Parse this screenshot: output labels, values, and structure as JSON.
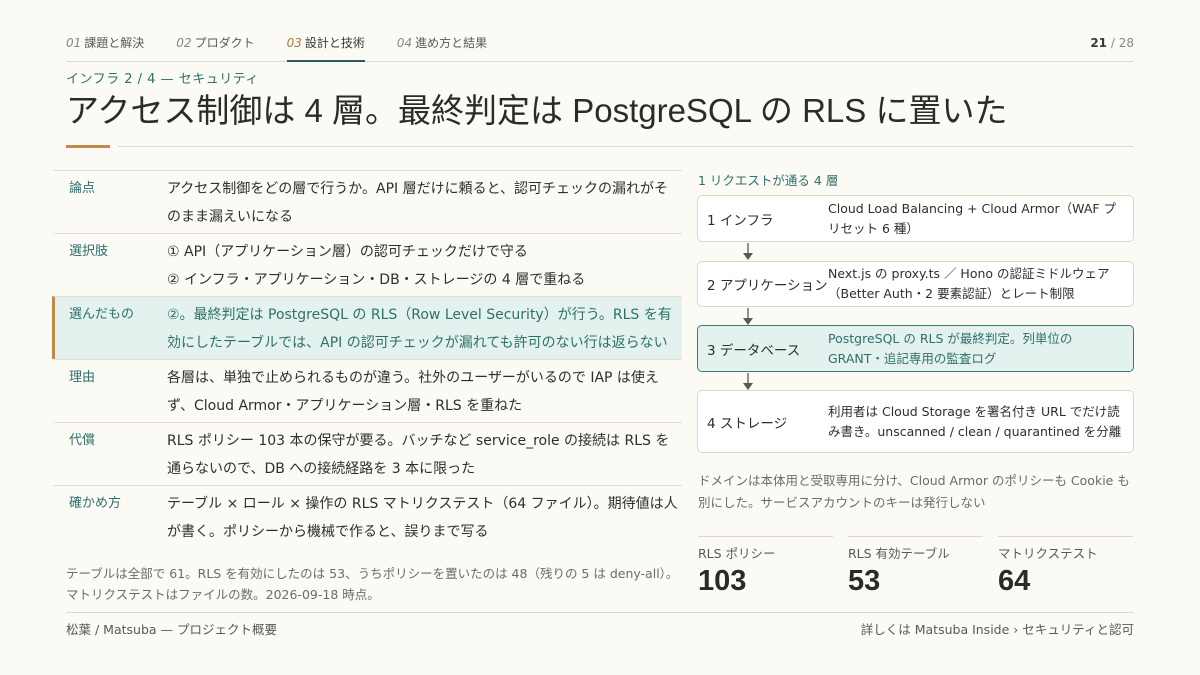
{
  "nav": {
    "tabs": [
      {
        "num": "01",
        "label": "課題と解決"
      },
      {
        "num": "02",
        "label": "プロダクト"
      },
      {
        "num": "03",
        "label": "設計と技術"
      },
      {
        "num": "04",
        "label": "進め方と結果"
      }
    ],
    "page_current": "21",
    "page_total": "/ 28"
  },
  "kicker": "インフラ 2 / 4 — セキュリティ",
  "title": "アクセス制御は 4 層。最終判定は PostgreSQL の RLS に置いた",
  "table": [
    {
      "label": "論点",
      "text": "アクセス制御をどの層で行うか。API 層だけに頼ると、認可チェックの漏れがそのまま漏えいになる"
    },
    {
      "label": "選択肢",
      "text": "① API（アプリケーション層）の認可チェックだけで守る",
      "text2": "② インフラ・アプリケーション・DB・ストレージの 4 層で重ねる"
    },
    {
      "label": "選んだもの",
      "text": "②。最終判定は PostgreSQL の RLS（Row Level Security）が行う。RLS を有効にしたテーブルでは、API の認可チェックが漏れても許可のない行は返らない"
    },
    {
      "label": "理由",
      "text": "各層は、単独で止められるものが違う。社外のユーザーがいるので IAP は使えず、Cloud Armor・アプリケーション層・RLS を重ねた"
    },
    {
      "label": "代償",
      "text": "RLS ポリシー 103 本の保守が要る。バッチなど service_role の接続は RLS を通らないので、DB への接続経路を 3 本に限った"
    },
    {
      "label": "確かめ方",
      "text": "テーブル × ロール × 操作の RLS マトリクステスト（64 ファイル）。期待値は人が書く。ポリシーから機械で作ると、誤りまで写る"
    }
  ],
  "footnote": "テーブルは全部で 61。RLS を有効にしたのは 53、うちポリシーを置いたのは 48（残りの 5 は deny-all）。マトリクステストはファイルの数。2026-09-18 時点。",
  "diagram": {
    "title": "1 リクエストが通る 4 層",
    "layers": [
      {
        "name": "1 インフラ",
        "desc": "Cloud Load Balancing + Cloud Armor（WAF プリセット 6 種）"
      },
      {
        "name": "2 アプリケーション",
        "desc": "Next.js の proxy.ts ／ Hono の認証ミドルウェア（Better Auth・2 要素認証）とレート制限"
      },
      {
        "name": "3 データベース",
        "desc": "PostgreSQL の RLS が最終判定。列単位の GRANT・追記専用の監査ログ"
      },
      {
        "name": "4 ストレージ",
        "desc": "利用者は Cloud Storage を署名付き URL でだけ読み書き。unscanned / clean / quarantined を分離"
      }
    ],
    "note": "ドメインは本体用と受取専用に分け、Cloud Armor のポリシーも Cookie も別にした。サービスアカウントのキーは発行しない"
  },
  "stats": [
    {
      "label": "RLS ポリシー",
      "value": "103"
    },
    {
      "label": "RLS 有効テーブル",
      "value": "53"
    },
    {
      "label": "マトリクステスト",
      "value": "64"
    }
  ],
  "footer": {
    "left": "松葉 / Matsuba — プロジェクト概要",
    "right": "詳しくは Matsuba Inside › セキュリティと認可"
  },
  "colors": {
    "accent": "#c08b4a",
    "teal": "#2f6f6a",
    "highlight": "#e4f2ef"
  }
}
